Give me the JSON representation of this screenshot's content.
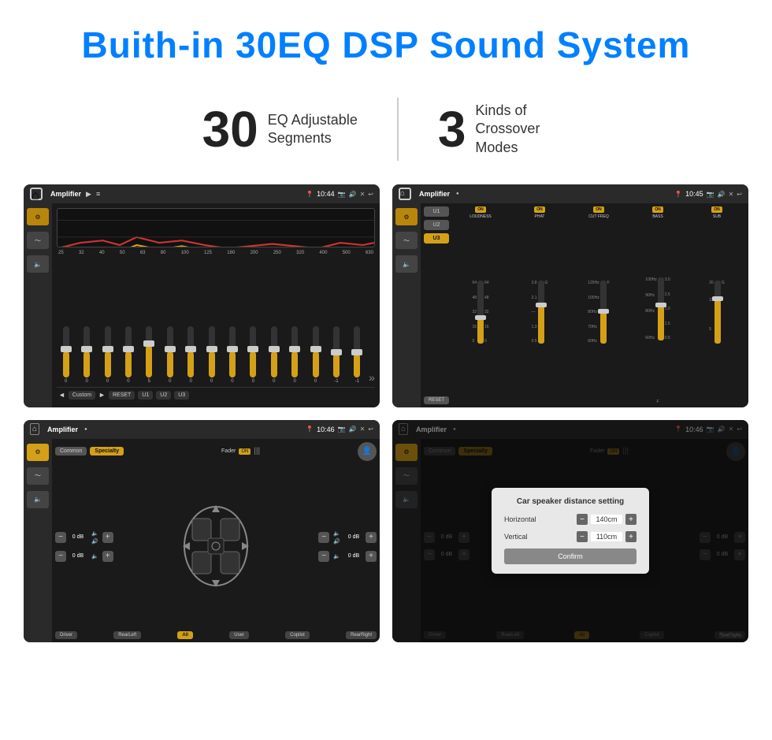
{
  "page": {
    "title": "Buith-in 30EQ DSP Sound System",
    "stat1_number": "30",
    "stat1_desc": "EQ Adjustable\nSegments",
    "stat2_number": "3",
    "stat2_desc": "Kinds of\nCrossover Modes"
  },
  "screens": {
    "screen1": {
      "app_title": "Amplifier",
      "time": "10:44",
      "eq_freqs": [
        "25",
        "32",
        "40",
        "50",
        "63",
        "80",
        "100",
        "125",
        "160",
        "200",
        "250",
        "320",
        "400",
        "500",
        "630"
      ],
      "eq_values": [
        "0",
        "0",
        "0",
        "0",
        "5",
        "0",
        "0",
        "0",
        "0",
        "0",
        "0",
        "0",
        "0",
        "-1",
        "0",
        "-1"
      ],
      "buttons": [
        "Custom",
        "RESET",
        "U1",
        "U2",
        "U3"
      ]
    },
    "screen2": {
      "app_title": "Amplifier",
      "time": "10:45",
      "presets": [
        "U1",
        "U2",
        "U3"
      ],
      "bands": [
        "LOUDNESS",
        "PHAT",
        "CUT FREQ",
        "BASS",
        "SUB"
      ],
      "reset_label": "RESET"
    },
    "screen3": {
      "app_title": "Amplifier",
      "time": "10:46",
      "tabs": [
        "Common",
        "Specialty"
      ],
      "fader_label": "Fader",
      "fader_on": "ON",
      "left_values": [
        "0 dB",
        "0 dB"
      ],
      "right_values": [
        "0 dB",
        "0 dB"
      ],
      "bottom_btns": [
        "Driver",
        "RearLeft",
        "All",
        "User",
        "Copilot",
        "RearRight"
      ]
    },
    "screen4": {
      "app_title": "Amplifier",
      "time": "10:46",
      "tabs": [
        "Common",
        "Specialty"
      ],
      "dialog_title": "Car speaker distance setting",
      "horizontal_label": "Horizontal",
      "horizontal_value": "140cm",
      "vertical_label": "Vertical",
      "vertical_value": "110cm",
      "confirm_label": "Confirm",
      "right_values": [
        "0 dB",
        "0 dB"
      ],
      "bottom_btns": [
        "Driver",
        "RearLeft",
        "All",
        "Copilot",
        "RearRight"
      ]
    }
  },
  "watermark": "Seicane"
}
